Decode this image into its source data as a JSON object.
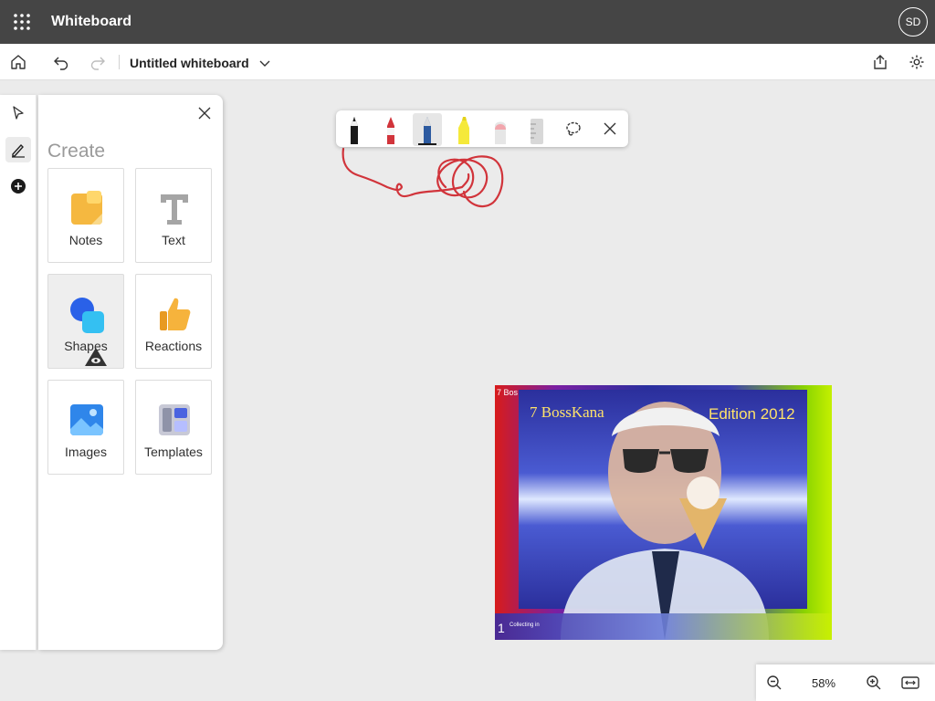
{
  "app": {
    "title": "Whiteboard"
  },
  "user": {
    "initials": "SD"
  },
  "document": {
    "title": "Untitled whiteboard"
  },
  "icons": {
    "app_launcher": "waffle-icon",
    "home": "home-icon",
    "undo": "undo-icon",
    "redo": "redo-icon",
    "title_dropdown": "chevron-down-icon",
    "share": "share-icon",
    "settings": "gear-icon",
    "select_tool": "pointer-icon",
    "ink_tool": "pen-icon",
    "create_tool": "add-icon",
    "close_panel": "close-icon",
    "lasso": "lasso-icon",
    "close_toolbar": "close-icon",
    "zoom_out": "zoom-out-icon",
    "zoom_in": "zoom-in-icon",
    "fit": "fit-to-screen-icon"
  },
  "create_panel": {
    "title": "Create",
    "items": [
      {
        "label": "Notes",
        "icon": "sticky-note-icon"
      },
      {
        "label": "Text",
        "icon": "text-icon"
      },
      {
        "label": "Shapes",
        "icon": "shapes-icon"
      },
      {
        "label": "Reactions",
        "icon": "thumbs-up-icon"
      },
      {
        "label": "Images",
        "icon": "image-icon"
      },
      {
        "label": "Templates",
        "icon": "templates-icon"
      }
    ]
  },
  "ink_toolbar": {
    "pens": [
      {
        "name": "black-pen",
        "color": "#1a1a1a"
      },
      {
        "name": "red-pen",
        "color": "#d1343b"
      },
      {
        "name": "blue-pen",
        "color": "#2c5aa0",
        "selected": true
      },
      {
        "name": "yellow-highlighter",
        "color": "#f5e93a"
      },
      {
        "name": "eraser",
        "color": "#f2a6ad"
      },
      {
        "name": "ruler",
        "color": "#c8c8c8"
      }
    ]
  },
  "canvas": {
    "ink_colors": {
      "red": "#d1343b",
      "purple": "#6a3fa0"
    },
    "pasted_image": {
      "title": "7 BossKana",
      "edition": "Edition 2012",
      "corner_text": "7 Bos",
      "number": "1",
      "status": "Collecting in"
    }
  },
  "zoom": {
    "level": "58%"
  }
}
